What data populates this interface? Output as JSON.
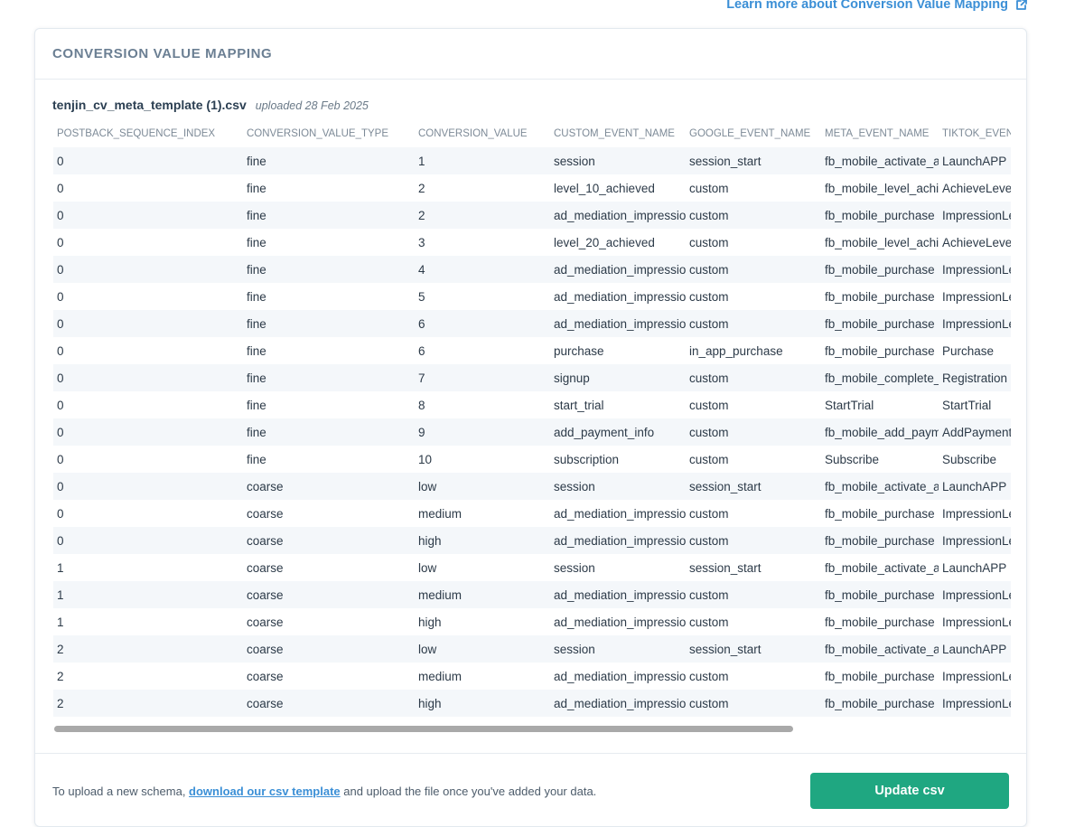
{
  "header": {
    "learn_more": "Learn more about Conversion Value Mapping"
  },
  "card": {
    "title": "CONVERSION VALUE MAPPING",
    "file_name": "tenjin_cv_meta_template (1).csv",
    "uploaded": "uploaded 28 Feb 2025"
  },
  "table": {
    "columns": [
      "POSTBACK_SEQUENCE_INDEX",
      "CONVERSION_VALUE_TYPE",
      "CONVERSION_VALUE",
      "CUSTOM_EVENT_NAME",
      "GOOGLE_EVENT_NAME",
      "META_EVENT_NAME",
      "TIKTOK_EVENT_NAME"
    ],
    "rows": [
      [
        "0",
        "fine",
        "1",
        "session",
        "session_start",
        "fb_mobile_activate_app",
        "LaunchAPP"
      ],
      [
        "0",
        "fine",
        "2",
        "level_10_achieved",
        "custom",
        "fb_mobile_level_achieved",
        "AchieveLevel"
      ],
      [
        "0",
        "fine",
        "2",
        "ad_mediation_impression",
        "custom",
        "fb_mobile_purchase",
        "ImpressionLevelAdRevenue"
      ],
      [
        "0",
        "fine",
        "3",
        "level_20_achieved",
        "custom",
        "fb_mobile_level_achieved",
        "AchieveLevel"
      ],
      [
        "0",
        "fine",
        "4",
        "ad_mediation_impression",
        "custom",
        "fb_mobile_purchase",
        "ImpressionLevelAdRevenue"
      ],
      [
        "0",
        "fine",
        "5",
        "ad_mediation_impression",
        "custom",
        "fb_mobile_purchase",
        "ImpressionLevelAdRevenue"
      ],
      [
        "0",
        "fine",
        "6",
        "ad_mediation_impression",
        "custom",
        "fb_mobile_purchase",
        "ImpressionLevelAdRevenue"
      ],
      [
        "0",
        "fine",
        "6",
        "purchase",
        "in_app_purchase",
        "fb_mobile_purchase",
        "Purchase"
      ],
      [
        "0",
        "fine",
        "7",
        "signup",
        "custom",
        "fb_mobile_complete_registration",
        "Registration"
      ],
      [
        "0",
        "fine",
        "8",
        "start_trial",
        "custom",
        "StartTrial",
        "StartTrial"
      ],
      [
        "0",
        "fine",
        "9",
        "add_payment_info",
        "custom",
        "fb_mobile_add_payment_info",
        "AddPaymentInfo"
      ],
      [
        "0",
        "fine",
        "10",
        "subscription",
        "custom",
        "Subscribe",
        "Subscribe"
      ],
      [
        "0",
        "coarse",
        "low",
        "session",
        "session_start",
        "fb_mobile_activate_app",
        "LaunchAPP"
      ],
      [
        "0",
        "coarse",
        "medium",
        "ad_mediation_impression",
        "custom",
        "fb_mobile_purchase",
        "ImpressionLevelAdRevenue"
      ],
      [
        "0",
        "coarse",
        "high",
        "ad_mediation_impression",
        "custom",
        "fb_mobile_purchase",
        "ImpressionLevelAdRevenue"
      ],
      [
        "1",
        "coarse",
        "low",
        "session",
        "session_start",
        "fb_mobile_activate_app",
        "LaunchAPP"
      ],
      [
        "1",
        "coarse",
        "medium",
        "ad_mediation_impression",
        "custom",
        "fb_mobile_purchase",
        "ImpressionLevelAdRevenue"
      ],
      [
        "1",
        "coarse",
        "high",
        "ad_mediation_impression",
        "custom",
        "fb_mobile_purchase",
        "ImpressionLevelAdRevenue"
      ],
      [
        "2",
        "coarse",
        "low",
        "session",
        "session_start",
        "fb_mobile_activate_app",
        "LaunchAPP"
      ],
      [
        "2",
        "coarse",
        "medium",
        "ad_mediation_impression",
        "custom",
        "fb_mobile_purchase",
        "ImpressionLevelAdRevenue"
      ],
      [
        "2",
        "coarse",
        "high",
        "ad_mediation_impression",
        "custom",
        "fb_mobile_purchase",
        "ImpressionLevelAdRevenue"
      ]
    ]
  },
  "footer": {
    "text_before": "To upload a new schema, ",
    "link": "download our csv template",
    "text_after": " and upload the file once you've added your data.",
    "button": "Update csv"
  },
  "colors": {
    "accent": "#3b8fd6",
    "primary_button": "#1fa781"
  },
  "icons": {
    "learn_more": "external-link-icon"
  }
}
